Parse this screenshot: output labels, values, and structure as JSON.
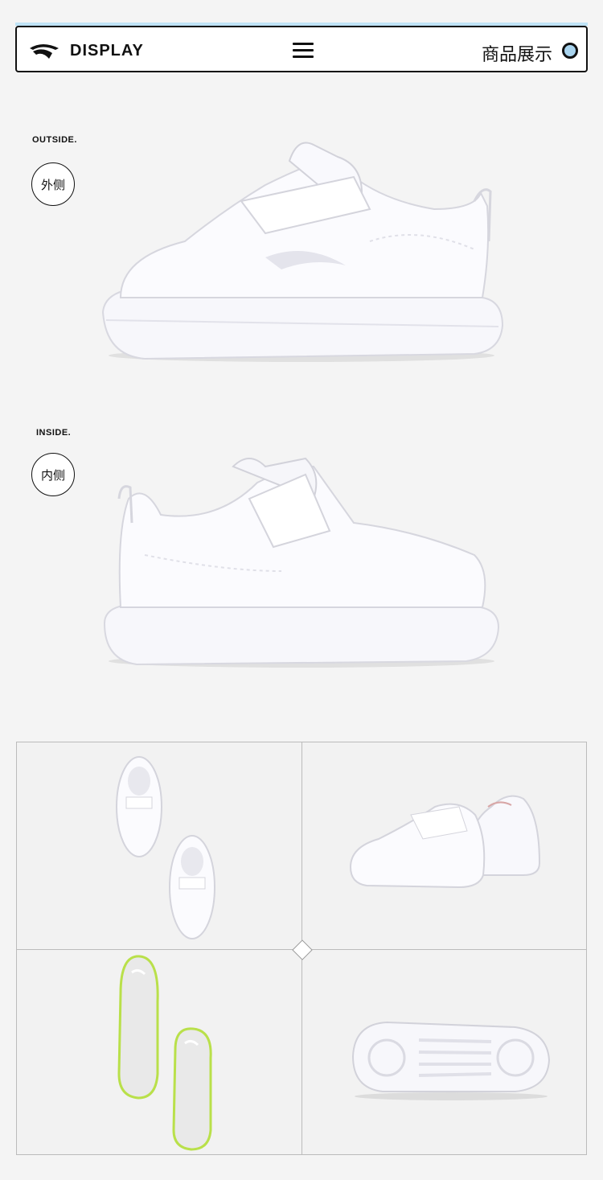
{
  "header": {
    "brand": "DISPLAY",
    "title": "商品展示"
  },
  "sections": [
    {
      "label_en": "OUTSIDE.",
      "label_cn": "外侧"
    },
    {
      "label_en": "INSIDE.",
      "label_cn": "内侧"
    }
  ],
  "colors": {
    "accent": "#a9d4ee",
    "background": "#f4f4f4",
    "insole_sole": "#b9e04a"
  },
  "icons": [
    "brand-logo-icon",
    "menu-icon",
    "status-dot-icon"
  ]
}
